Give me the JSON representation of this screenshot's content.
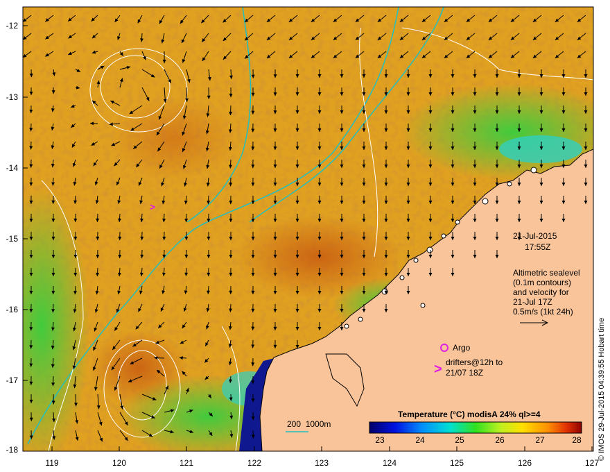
{
  "map": {
    "y_axis_ticks": [
      "-12",
      "-13",
      "-14",
      "-15",
      "-16",
      "-17",
      "-18"
    ],
    "x_axis_ticks": [
      "119",
      "120",
      "121",
      "122",
      "123",
      "124",
      "125",
      "126",
      "127"
    ],
    "date_text": "21-Jul-2015",
    "time_text": "17:55Z",
    "altimetry_lines": [
      "Altimetric sealevel",
      "(0.1m contours)",
      "and velocity for",
      "21-Jul 17Z",
      "0.5m/s (1kt 24h)"
    ],
    "argo_label": "Argo",
    "drifter_lines": [
      "drifters@12h to",
      "21/07 18Z"
    ],
    "bathymetry_label": "200  1000m",
    "credit": "© IMOS 29-Jul-2015 04:39:55 Hobart time",
    "colorbar": {
      "title": "Temperature  (°C) modisA 24% ql>=4",
      "ticks": [
        "23",
        "24",
        "25",
        "26",
        "27",
        "28"
      ]
    },
    "colors": {
      "land": "#f9c49a",
      "warm_sea": "#e0a020",
      "cool_sea": "#20c040",
      "cold_sea": "#101890",
      "argo_marker": "#e020e0",
      "bathymetry_contour": "#20c0c0"
    }
  }
}
